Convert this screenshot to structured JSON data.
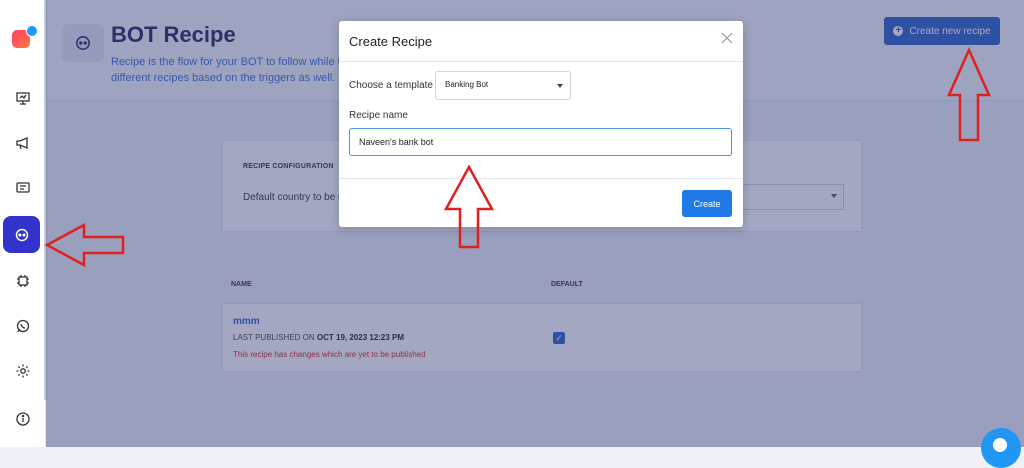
{
  "sidebar": {
    "logo": "app-logo",
    "items": [
      {
        "name": "presentation-icon",
        "active": false
      },
      {
        "name": "megaphone-icon",
        "active": false
      },
      {
        "name": "chat-icon",
        "active": false
      },
      {
        "name": "bot-chat-icon",
        "active": true
      },
      {
        "name": "chip-icon",
        "active": false
      },
      {
        "name": "whatsapp-icon",
        "active": false
      },
      {
        "name": "gear-icon",
        "active": false
      },
      {
        "name": "info-icon",
        "active": false
      }
    ]
  },
  "header": {
    "title": "BOT Recipe",
    "description_line1": "Recipe is the flow for your BOT to follow while talk",
    "description_line2": "different recipes based on the triggers as well. Le",
    "create_button": "Create new recipe"
  },
  "config": {
    "title": "RECIPE CONFIGURATION",
    "country_label": "Default country to be u"
  },
  "table": {
    "columns": [
      "NAME",
      "DEFAULT"
    ],
    "rows": [
      {
        "name": "mmm",
        "published_prefix": "LAST PUBLISHED ON ",
        "published_date": "OCT 19, 2023 12:23 PM",
        "warning": "This recipe has changes which are yet to be published",
        "default": true
      }
    ]
  },
  "modal": {
    "title": "Create Recipe",
    "template_label": "Choose a template",
    "template_value": "Banking Bot",
    "recipe_name_label": "Recipe name",
    "recipe_name_value": "Naveen's bank bot",
    "create_button": "Create"
  },
  "colors": {
    "accent": "#2d63c9",
    "annotation_arrow": "#e02020",
    "active_nav": "#3333cc"
  }
}
